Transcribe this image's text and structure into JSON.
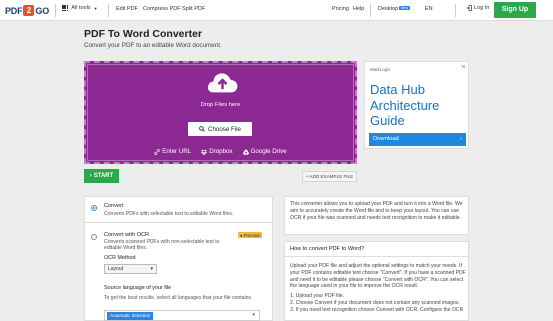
{
  "header": {
    "logo": {
      "pdf": "PDF",
      "two": "2",
      "go": "GO"
    },
    "all_tools": "All tools",
    "nav": [
      "Edit PDF",
      "Compress PDF",
      "Split PDF"
    ],
    "pricing": "Pricing",
    "help": "Help",
    "desktop": "Desktop",
    "desktop_badge": "New",
    "language": "EN",
    "login": "Log In",
    "signup": "Sign Up"
  },
  "page": {
    "title": "PDF To Word Converter",
    "subtitle": "Convert your PDF to an editable Word document."
  },
  "upload": {
    "drop_label": "Drop Files here",
    "choose_file": "Choose File",
    "sources": [
      "Enter URL",
      "Dropbox",
      "Google Drive"
    ],
    "start": "START",
    "add_example": "+ ADD EXAMPLE FILE"
  },
  "ad": {
    "brand": "MarkLogic",
    "headline": [
      "Data Hub",
      "Architecture",
      "Guide"
    ],
    "cta": "Download"
  },
  "options": {
    "option1": {
      "title": "Convert",
      "desc": "Converts PDFs with selectable text to editable Word files.",
      "selected": true
    },
    "option2": {
      "title": "Convert with OCR",
      "desc1": "Converts scanned PDFs with non-selectable text to",
      "desc2": "editable Word files.",
      "badge": "Premium",
      "selected": false
    },
    "ocr_method_label": "OCR Method",
    "ocr_method_value": "Layout",
    "source_lang_label": "Source language of your file",
    "source_lang_desc": "To get the best results, select all languages that your file contains.",
    "source_lang_chip": "Automatic detection"
  },
  "info": {
    "intro": "This converter allows you to upload your PDF and turn it into a Word file. We aim to accurately create the Word file and to keep your layout. You can use OCR if your file was scanned and needs text recognition to make it editable.",
    "howto_title": "How to convert PDF to Word?",
    "howto_body": "Upload your PDF file and adjust the optional settings to match your needs. If your PDF contains editable text choose \"Convert\". If you have a scanned PDF and need it to be editable please choose \"Convert with OCR\". You can select the language used in your file to improve the OCR result.",
    "steps": [
      "1. Upload your PDF file.",
      "2. Choose Convert if your document does not contain any scanned images.",
      "3. If you need text recognition choose Convert with OCR. Configure the OCR"
    ]
  },
  "colors": {
    "upload_bg": "#8c2892",
    "green": "#2ba84a",
    "blue": "#2d84e0",
    "premium": "#f4b63b"
  }
}
